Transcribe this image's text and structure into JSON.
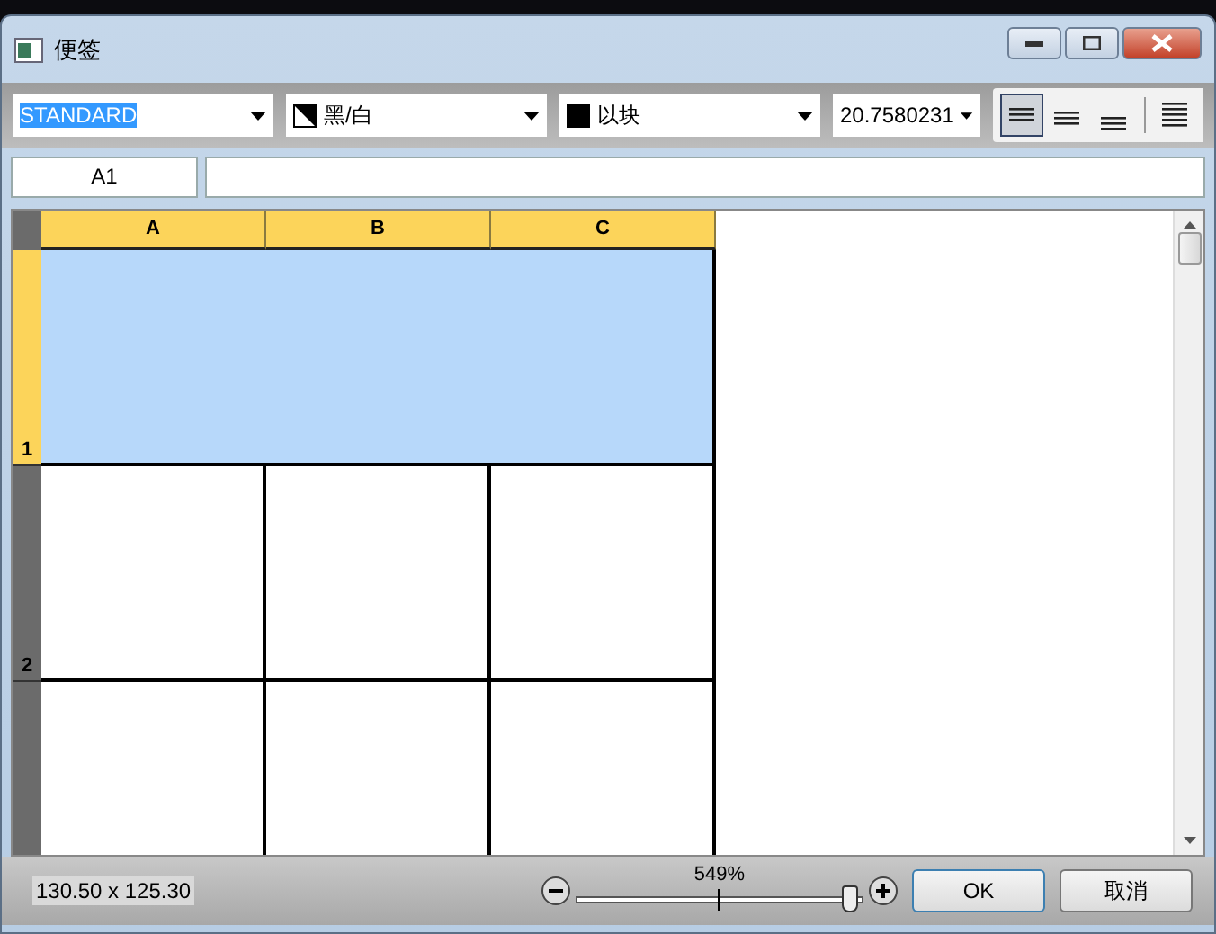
{
  "window": {
    "title": "便签"
  },
  "toolbar": {
    "style": {
      "value": "STANDARD",
      "highlighted": true
    },
    "color": {
      "value": "黑/白"
    },
    "fill": {
      "value": "以块"
    },
    "height": {
      "value": "20.7580231"
    },
    "align_buttons": [
      {
        "kind": "top",
        "selected": true
      },
      {
        "kind": "middle",
        "selected": false
      },
      {
        "kind": "bottom",
        "selected": false
      },
      {
        "kind": "justify",
        "selected": false
      }
    ]
  },
  "cell_reference": "A1",
  "grid": {
    "columns": [
      {
        "label": "A",
        "selected": true
      },
      {
        "label": "B",
        "selected": true
      },
      {
        "label": "C",
        "selected": true
      }
    ],
    "rows": [
      {
        "label": "1",
        "selected": true,
        "kind": "merged"
      },
      {
        "label": "2",
        "selected": false,
        "kind": "cells"
      },
      {
        "selected": false,
        "kind": "cells"
      }
    ]
  },
  "status_bar": {
    "size": "130.50 x 125.30",
    "zoom": "549%",
    "level": 0.95,
    "buttons": [
      "OK",
      "取消"
    ]
  }
}
